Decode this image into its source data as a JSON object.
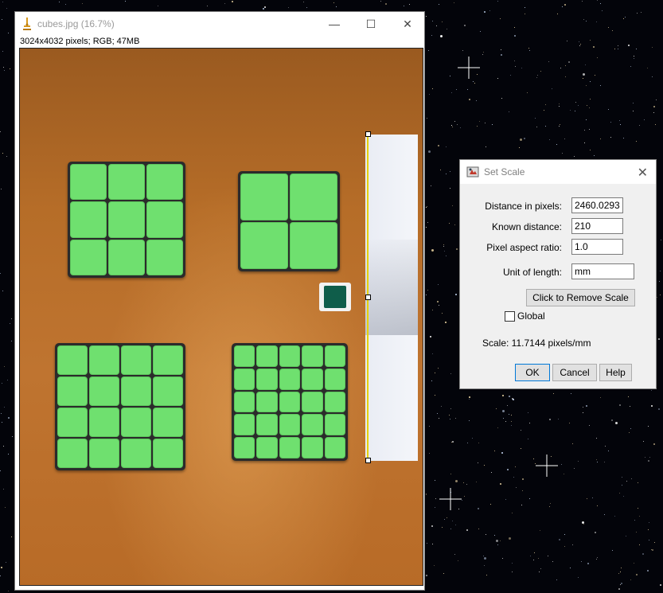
{
  "image_window": {
    "title": "cubes.jpg (16.7%)",
    "info": "3024x4032 pixels; RGB; 47MB",
    "minimize_symbol": "—",
    "maximize_symbol": "☐",
    "close_symbol": "✕",
    "icon": "imagej-microscope-icon"
  },
  "set_scale_dialog": {
    "title": "Set Scale",
    "close_symbol": "✕",
    "fields": {
      "distance_in_pixels": {
        "label": "Distance in pixels:",
        "value": "2460.0293"
      },
      "known_distance": {
        "label": "Known distance:",
        "value": "210"
      },
      "pixel_aspect_ratio": {
        "label": "Pixel aspect ratio:",
        "value": "1.0"
      },
      "unit_of_length": {
        "label": "Unit of length:",
        "value": "mm"
      }
    },
    "remove_scale_label": "Click to Remove Scale",
    "global_label": "Global",
    "global_checked": false,
    "scale_text": "Scale: 11.7144 pixels/mm",
    "ok_label": "OK",
    "cancel_label": "Cancel",
    "help_label": "Help"
  },
  "colors": {
    "cube_green": "#6fe06f",
    "selection_yellow": "#e6d200",
    "desktop": "#03040a"
  }
}
